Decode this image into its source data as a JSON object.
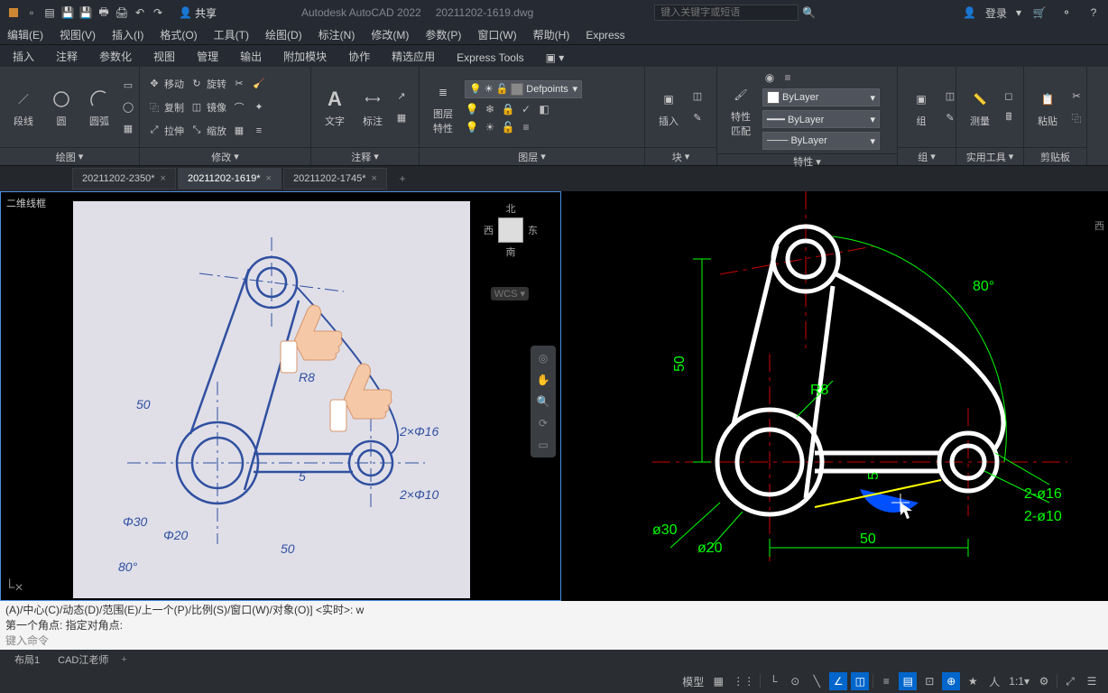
{
  "titlebar": {
    "app": "Autodesk AutoCAD 2022",
    "file": "20211202-1619.dwg",
    "share": "共享",
    "search_placeholder": "键入关键字或短语",
    "login": "登录"
  },
  "menubar": {
    "items": [
      "编辑(E)",
      "视图(V)",
      "插入(I)",
      "格式(O)",
      "工具(T)",
      "绘图(D)",
      "标注(N)",
      "修改(M)",
      "参数(P)",
      "窗口(W)",
      "帮助(H)",
      "Express"
    ]
  },
  "ribtabs": {
    "items": [
      "插入",
      "注释",
      "参数化",
      "视图",
      "管理",
      "输出",
      "附加模块",
      "协作",
      "精选应用",
      "Express Tools"
    ]
  },
  "ribbon": {
    "draw": {
      "title": "绘图",
      "btn_line": "段线",
      "btn_circle": "圆",
      "btn_arc": "圆弧"
    },
    "modify": {
      "title": "修改",
      "move": "移动",
      "rotate": "旋转",
      "copy": "复制",
      "mirror": "镜像",
      "stretch": "拉伸",
      "scale": "缩放"
    },
    "annotate": {
      "title": "注释",
      "text": "文字",
      "dim": "标注"
    },
    "layer": {
      "title": "图层",
      "props": "图层\n特性",
      "current": "Defpoints"
    },
    "block": {
      "title": "块",
      "insert": "插入"
    },
    "prop": {
      "title": "特性",
      "match": "特性\n匹配",
      "bylayer": "ByLayer"
    },
    "group": {
      "title": "组",
      "g": "组"
    },
    "util": {
      "title": "实用工具",
      "measure": "测量"
    },
    "clip": {
      "title": "剪贴板",
      "paste": "粘贴"
    }
  },
  "doctabs": {
    "tabs": [
      {
        "name": "20211202-2350*",
        "active": false
      },
      {
        "name": "20211202-1619*",
        "active": true
      },
      {
        "name": "20211202-1745*",
        "active": false
      }
    ]
  },
  "viewport": {
    "label": "二维线框",
    "cube": {
      "n": "北",
      "s": "南",
      "e": "东",
      "w": "西"
    },
    "wcs": "WCS"
  },
  "drawing": {
    "dims": {
      "d50v": "50",
      "d50h": "50",
      "r8": "R8",
      "phi30": "Φ30",
      "phi20": "Φ20",
      "ang80": "80°",
      "d2phi16": "2×Φ16",
      "d2phi10": "2×Φ10",
      "d5": "5"
    },
    "dims2": {
      "d50v": "50",
      "d50h": "50",
      "r8": "R8",
      "phi30": "ø30",
      "phi20": "ø20",
      "ang80": "80°",
      "d2phi16": "2-ø16",
      "d2phi10": "2-ø10",
      "d5": "5"
    }
  },
  "cmd": {
    "line1": "(A)/中心(C)/动态(D)/范围(E)/上一个(P)/比例(S)/窗口(W)/对象(O)] <实时>: w",
    "line2": "第一个角点: 指定对角点:",
    "prompt": "键入命令"
  },
  "btabs": {
    "items": [
      "布局1",
      "CAD江老师"
    ]
  },
  "status": {
    "model": "模型",
    "scale": "1:1"
  }
}
